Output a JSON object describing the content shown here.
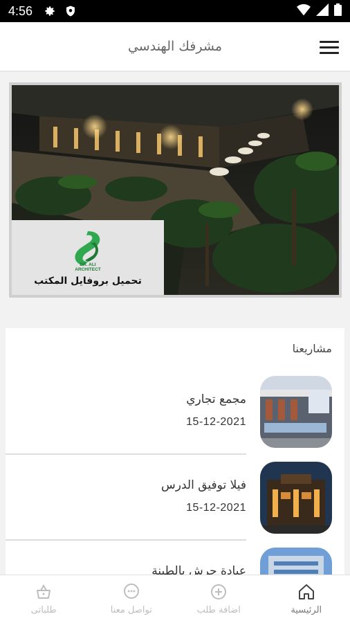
{
  "status_bar": {
    "time": "4:56"
  },
  "app_bar": {
    "title": "مشرفك الهندسي"
  },
  "banner": {
    "profile_label": "تحميل بروفايل المكتب"
  },
  "projects": {
    "title": "مشاريعنا",
    "items": [
      {
        "name": "مجمع تجاري",
        "date": "15-12-2021"
      },
      {
        "name": "فيلا توفيق الدرس",
        "date": "15-12-2021"
      },
      {
        "name": "عيادة جرش بالطينة",
        "date": ""
      }
    ]
  },
  "bottom_nav": {
    "items": [
      {
        "label": "الرئيسية",
        "icon": "home-icon"
      },
      {
        "label": "اضافة طلب",
        "icon": "add-circle-icon"
      },
      {
        "label": "تواصل معنا",
        "icon": "chat-icon"
      },
      {
        "label": "طلباتى",
        "icon": "basket-icon"
      }
    ]
  },
  "colors": {
    "accent_green": "#2fa84f",
    "nav_inactive": "#bdbdbd"
  }
}
